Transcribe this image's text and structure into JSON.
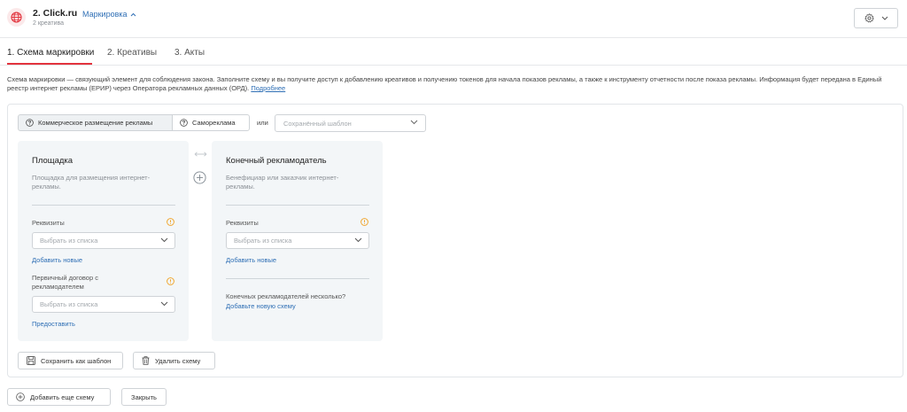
{
  "header": {
    "app_title": "2. Click.ru",
    "app_subtitle": "2 креатива",
    "marking_link": "Маркировка"
  },
  "tabs": [
    {
      "label": "1. Схема маркировки",
      "active": true
    },
    {
      "label": "2. Креативы",
      "active": false
    },
    {
      "label": "3. Акты",
      "active": false
    }
  ],
  "description": {
    "text": "Схема маркировки — связующий элемент для соблюдения закона. Заполните схему и вы получите доступ к добавлению креативов и получению токенов для начала показов рекламы, а также к инструменту отчетности после показа рекламы. Информация будет передана в Единый реестр интернет рекламы (ЕРИР) через Оператора рекламных данных (ОРД). ",
    "link": "Подробнее"
  },
  "scheme": {
    "segments": [
      {
        "label": "Коммерческое размещение рекламы",
        "active": true
      },
      {
        "label": "Самореклама",
        "active": false
      }
    ],
    "or_label": "или",
    "template_placeholder": "Сохранённый шаблон",
    "platform": {
      "title": "Площадка",
      "desc": "Площадка для размещения интернет-рекламы.",
      "requisites_label": "Реквизиты",
      "requisites_placeholder": "Выбрать из списка",
      "add_new": "Добавить новые",
      "contract_label": "Первичный договор с рекламодателем",
      "contract_placeholder": "Выбрать из списка",
      "provide": "Предоставить"
    },
    "advertiser": {
      "title": "Конечный рекламодатель",
      "desc": "Бенефициар или заказчик интернет-рекламы.",
      "requisites_label": "Реквизиты",
      "requisites_placeholder": "Выбрать из списка",
      "add_new": "Добавить новые",
      "note": "Конечных рекламодателей несколько?",
      "add_scheme_link": "Добавьте новую схему"
    },
    "save_template": "Сохранить как шаблон",
    "delete_scheme": "Удалить схему"
  },
  "footer": {
    "add_scheme": "Добавить еще схему",
    "close": "Закрыть"
  },
  "colors": {
    "accent_red": "#e2333d",
    "link_blue": "#2f6fb5",
    "warning_orange": "#f0a020"
  }
}
